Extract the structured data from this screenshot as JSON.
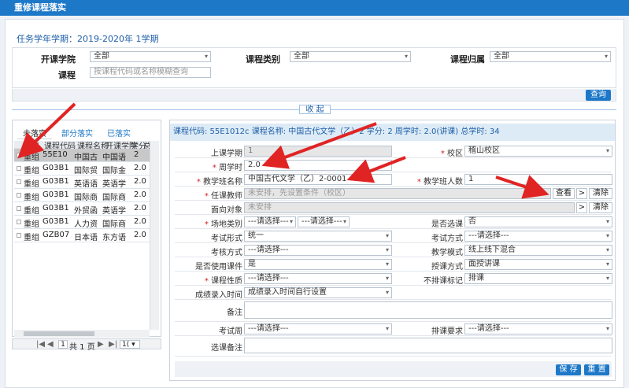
{
  "header": {
    "title": "重修课程落实"
  },
  "term": "任务学年学期：2019-2020年 1学期",
  "filters": {
    "college_label": "开课学院",
    "college_value": "全部",
    "category_label": "课程类别",
    "category_value": "全部",
    "belong_label": "课程归属",
    "belong_value": "全部",
    "course_label": "课程",
    "course_placeholder": "按课程代码或名称模糊查询",
    "query_button": "查询"
  },
  "collapse_label": "收 起",
  "tabs": [
    "未落实",
    "部分落实",
    "已落实"
  ],
  "grid": {
    "headers": [
      "重修",
      "课程代码",
      "课程名称",
      "开课学院",
      "学分",
      "总"
    ],
    "rows": [
      [
        "重组",
        "55E10",
        "中国古",
        "中国语",
        "2"
      ],
      [
        "重组",
        "G03B1",
        "国际贸",
        "国际金",
        "2.0"
      ],
      [
        "重组",
        "G03B1",
        "英语语",
        "英语学",
        "2.0"
      ],
      [
        "重组",
        "G03B1",
        "国际商",
        "国际商",
        "2.0"
      ],
      [
        "重组",
        "G03B1",
        "外贸函",
        "英语学",
        "2.0"
      ],
      [
        "重组",
        "G03B1",
        "人力资",
        "国际商",
        "2.0"
      ],
      [
        "重组",
        "GZB07",
        "日本语",
        "东方语",
        "2.0"
      ]
    ]
  },
  "pager": {
    "page_text": "共 1 页",
    "page_num": "1",
    "page_size": "1("
  },
  "course_info": "课程代码: 55E1012c  课程名称: 中国古代文学（乙）2  学分: 2  周学时: 2.0(讲课)  总学时: 34",
  "form": {
    "term_label": "上课学期",
    "term_value": "1",
    "campus_label": "校区",
    "campus_value": "稽山校区",
    "weekly_label": "周学时",
    "weekly_value": "2.0",
    "class_name_label": "教学班名称",
    "class_name_value": "中国古代文学（乙）2-0001",
    "class_size_label": "教学班人数",
    "class_size_value": "1",
    "teacher_label": "任课教师",
    "teacher_placeholder": "未安排，先设置条件（校区）",
    "view_button": "查看",
    "more_button": ">",
    "clear_button": "清除",
    "target_label": "面向对象",
    "target_placeholder": "未安排",
    "target_more": ">",
    "target_clear": "清除",
    "venue_label": "场地类别",
    "venue_value1": "---请选择---",
    "venue_value2": "---请选择---",
    "elective_label": "是否选课",
    "elective_value": "否",
    "exam_form_label": "考试形式",
    "exam_form_value": "统一",
    "exam_method_label": "考试方式",
    "exam_method_value": "---请选择---",
    "assess_label": "考核方式",
    "assess_value": "---请选择---",
    "teach_mode_label": "教学模式",
    "teach_mode_value": "线上线下混合",
    "courseware_label": "是否使用课件",
    "courseware_value": "是",
    "lecture_label": "授课方式",
    "lecture_value": "面授讲课",
    "nature_label": "课程性质",
    "nature_value": "---请选择---",
    "nosched_label": "不排课标记",
    "nosched_value": "排课",
    "grade_label": "成绩录入时间",
    "grade_value": "成绩录入时间自行设置",
    "remark_label": "备注",
    "exam_week_label": "考试周",
    "exam_week_value": "---请选择---",
    "sched_req_label": "排课要求",
    "sched_req_value": "---请选择---",
    "elective_remark_label": "选课备注",
    "save_button": "保 存",
    "reset_button": "重 置"
  },
  "colors": {
    "brand": "#1e78c8",
    "arrow": "#e02424"
  }
}
